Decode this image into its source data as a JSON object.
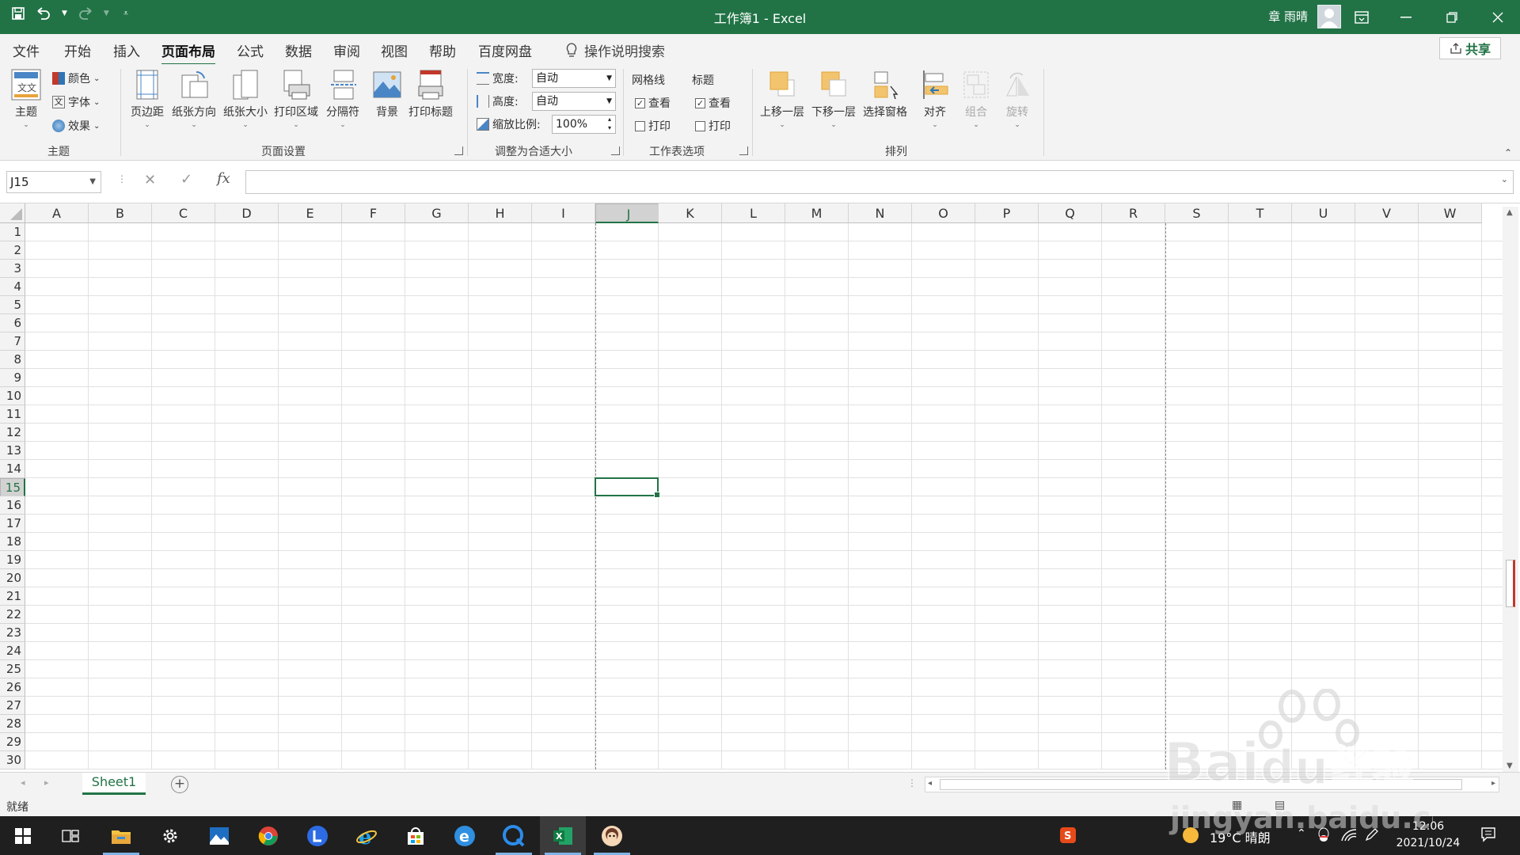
{
  "app": {
    "title": "工作簿1  -  Excel",
    "user": "章 雨晴",
    "accent": "#217346"
  },
  "tabs": [
    {
      "label": "文件"
    },
    {
      "label": "开始"
    },
    {
      "label": "插入"
    },
    {
      "label": "页面布局"
    },
    {
      "label": "公式"
    },
    {
      "label": "数据"
    },
    {
      "label": "审阅"
    },
    {
      "label": "视图"
    },
    {
      "label": "帮助"
    },
    {
      "label": "百度网盘"
    }
  ],
  "active_tab": "页面布局",
  "tell_me": "操作说明搜索",
  "share": "共享",
  "ribbon": {
    "themes_group": {
      "theme": "主题",
      "colors": "颜色",
      "fonts": "字体",
      "effects": "效果",
      "label": "主题"
    },
    "page_setup": {
      "margins": "页边距",
      "orientation": "纸张方向",
      "size": "纸张大小",
      "print_area": "打印区域",
      "breaks": "分隔符",
      "background": "背景",
      "print_titles": "打印标题",
      "label": "页面设置"
    },
    "scale": {
      "width_label": "宽度:",
      "width_value": "自动",
      "height_label": "高度:",
      "height_value": "自动",
      "scale_label": "缩放比例:",
      "scale_value": "100%",
      "label": "调整为合适大小"
    },
    "sheet_options": {
      "gridlines": "网格线",
      "headings": "标题",
      "view": "查看",
      "print": "打印",
      "gridlines_view": true,
      "gridlines_print": false,
      "headings_view": true,
      "headings_print": false,
      "label": "工作表选项"
    },
    "arrange": {
      "bring_forward": "上移一层",
      "send_backward": "下移一层",
      "selection_pane": "选择窗格",
      "align": "对齐",
      "group": "组合",
      "rotate": "旋转",
      "label": "排列"
    }
  },
  "formula_bar": {
    "name_box": "J15",
    "fx": "fx",
    "formula": ""
  },
  "grid": {
    "columns": [
      "A",
      "B",
      "C",
      "D",
      "E",
      "F",
      "G",
      "H",
      "I",
      "J",
      "K",
      "L",
      "M",
      "N",
      "O",
      "P",
      "Q",
      "R",
      "S",
      "T",
      "U",
      "V",
      "W"
    ],
    "rows": [
      "1",
      "2",
      "3",
      "4",
      "5",
      "6",
      "7",
      "8",
      "9",
      "10",
      "11",
      "12",
      "13",
      "14",
      "15",
      "16",
      "17",
      "18",
      "19",
      "20",
      "21",
      "22",
      "23",
      "24",
      "25",
      "26",
      "27",
      "28",
      "29",
      "30"
    ],
    "active_column": "J",
    "active_row": "15"
  },
  "sheets": [
    {
      "name": "Sheet1",
      "active": true
    }
  ],
  "status": {
    "ready": "就绪"
  },
  "taskbar": {
    "weather": "19°C  晴朗",
    "time": "12:06",
    "date": "2021/10/24",
    "apps": [
      "start",
      "task-view",
      "file-explorer",
      "settings",
      "photos",
      "chrome",
      "l-app",
      "ie",
      "store",
      "edge",
      "q-app",
      "excel",
      "avatar-app"
    ]
  },
  "watermark": {
    "brand": "Baidu经验",
    "url": "jingyan.baidu.com"
  }
}
